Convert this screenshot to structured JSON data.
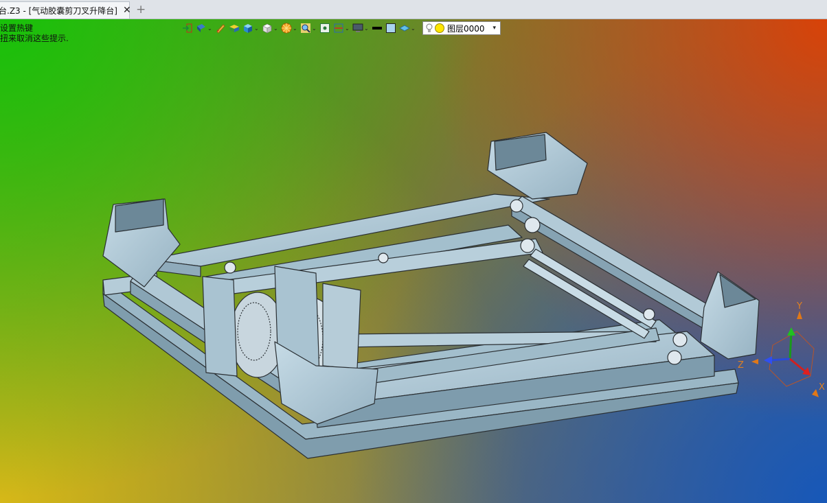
{
  "tab": {
    "title": "台.Z3 - [气动胶囊剪刀叉升降台]",
    "close": "✕",
    "new": "+"
  },
  "hints": {
    "line1": "设置热键",
    "line2": "扭来取消这些提示."
  },
  "toolbar": {
    "buttons": [
      {
        "icon": "import-icon",
        "dropdown": false
      },
      {
        "icon": "render-mode-icon",
        "dropdown": true
      },
      {
        "icon": "pencil-icon",
        "dropdown": false
      },
      {
        "icon": "shaded-box-icon",
        "dropdown": false
      },
      {
        "icon": "blue-cube-icon",
        "dropdown": true
      },
      {
        "icon": "white-cube-icon",
        "dropdown": true
      },
      {
        "icon": "orange-wheel-icon",
        "dropdown": true
      },
      {
        "icon": "zoom-icon",
        "dropdown": true
      },
      {
        "icon": "fit-view-icon",
        "dropdown": false
      },
      {
        "icon": "section-icon",
        "dropdown": true
      },
      {
        "icon": "display-icon",
        "dropdown": true
      },
      {
        "icon": "black-line-icon",
        "dropdown": false
      },
      {
        "icon": "color-square-icon",
        "dropdown": false
      },
      {
        "icon": "layer-plane-icon",
        "dropdown": true
      }
    ],
    "layer": {
      "value": "图层0000",
      "arrow": "▾"
    }
  },
  "triad": {
    "x": "X",
    "y": "Y",
    "z": "Z"
  },
  "colors": {
    "part_fill": "#a9c3d1",
    "part_edge": "#2a2f33"
  }
}
